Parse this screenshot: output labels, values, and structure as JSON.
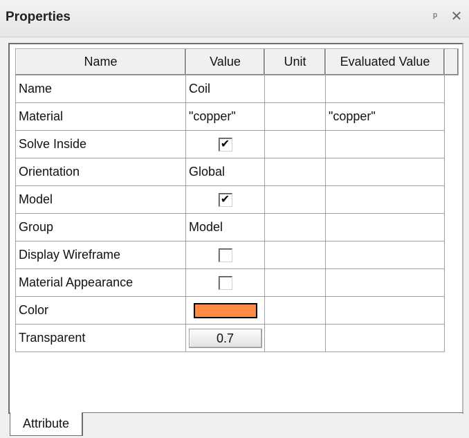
{
  "panel": {
    "title": "Properties",
    "pin_icon": "pin-icon",
    "close_icon": "close-icon"
  },
  "table": {
    "columns": [
      "Name",
      "Value",
      "Unit",
      "Evaluated Value"
    ],
    "rows": [
      {
        "name": "Name",
        "value": "Coil",
        "unit": "",
        "evaluated": ""
      },
      {
        "name": "Material",
        "value": "\"copper\"",
        "unit": "",
        "evaluated": "\"copper\""
      },
      {
        "name": "Solve Inside",
        "value": "✔",
        "unit": "",
        "evaluated": ""
      },
      {
        "name": "Orientation",
        "value": "Global",
        "unit": "",
        "evaluated": ""
      },
      {
        "name": "Model",
        "value": "✔",
        "unit": "",
        "evaluated": ""
      },
      {
        "name": "Group",
        "value": "Model",
        "unit": "",
        "evaluated": ""
      },
      {
        "name": "Display Wireframe",
        "value": "",
        "unit": "",
        "evaluated": ""
      },
      {
        "name": "Material Appearance",
        "value": "",
        "unit": "",
        "evaluated": ""
      },
      {
        "name": "Color",
        "value": "",
        "unit": "",
        "evaluated": ""
      },
      {
        "name": "Transparent",
        "value": "0.7",
        "unit": "",
        "evaluated": ""
      }
    ],
    "color_swatch": "#ff8a45"
  },
  "tabs": [
    {
      "label": "Attribute",
      "active": true
    }
  ]
}
